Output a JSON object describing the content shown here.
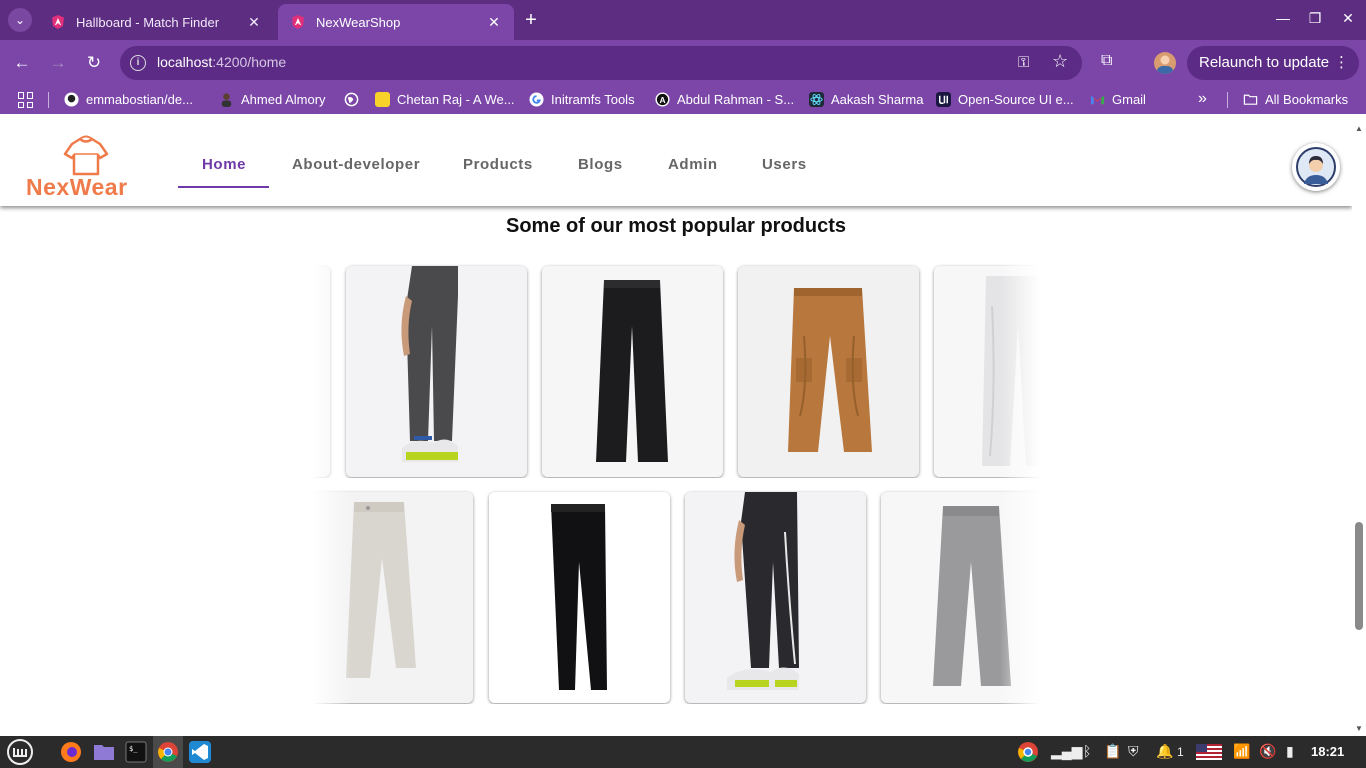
{
  "browser": {
    "tabs": [
      {
        "title": "Hallboard - Match Finder",
        "close": "✕"
      },
      {
        "title": "NexWearShop",
        "close": "✕"
      }
    ],
    "new_tab": "+",
    "window_controls": {
      "minimize": "—",
      "maximize": "❐",
      "close": "✕"
    },
    "url": {
      "host": "localhost",
      "path": ":4200/home"
    },
    "relaunch_label": "Relaunch to update",
    "bookmarks": [
      {
        "label": "emmabostian/de...",
        "icon": "github-icon"
      },
      {
        "label": "Ahmed Almory",
        "icon": "person-icon"
      },
      {
        "label": "",
        "icon": "globe-icon"
      },
      {
        "label": "Chetan Raj - A We...",
        "icon": "yellow-square-icon"
      },
      {
        "label": "Initramfs Tools",
        "icon": "google-icon"
      },
      {
        "label": "Abdul Rahman - S...",
        "icon": "letter-a-icon"
      },
      {
        "label": "Aakash Sharma",
        "icon": "react-icon"
      },
      {
        "label": "Open-Source UI e...",
        "icon": "dark-square-icon"
      },
      {
        "label": "Gmail",
        "icon": "gmail-icon"
      }
    ],
    "bookmarks_overflow": "»",
    "all_bookmarks": "All Bookmarks"
  },
  "site": {
    "logo_text": "NexWear",
    "nav": [
      {
        "label": "Home",
        "active": true
      },
      {
        "label": "About-developer",
        "active": false
      },
      {
        "label": "Products",
        "active": false
      },
      {
        "label": "Blogs",
        "active": false
      },
      {
        "label": "Admin",
        "active": false
      },
      {
        "label": "Users",
        "active": false
      }
    ],
    "section_title": "Some of our most popular products",
    "products_row1": [
      {
        "desc": "grey-track-pants-model",
        "color": "#4a4a4d"
      },
      {
        "desc": "black-wide-trousers",
        "color": "#1c1c1e"
      },
      {
        "desc": "tan-cargo-pants",
        "color": "#b8773c"
      },
      {
        "desc": "white-trousers",
        "color": "#e6e6e8"
      }
    ],
    "products_row2": [
      {
        "desc": "beige-chinos",
        "color": "#d9d6cf"
      },
      {
        "desc": "black-slim-pants",
        "color": "#111113"
      },
      {
        "desc": "black-track-pants-model",
        "color": "#2a2a2e"
      },
      {
        "desc": "grey-wide-trousers",
        "color": "#9a9a9c"
      }
    ]
  },
  "taskbar": {
    "clock": "18:21",
    "notification_count": "1"
  },
  "colors": {
    "brand_orange": "#f07b4a",
    "nav_active": "#6f3aa8",
    "chrome_purple": "#7b46a8"
  }
}
